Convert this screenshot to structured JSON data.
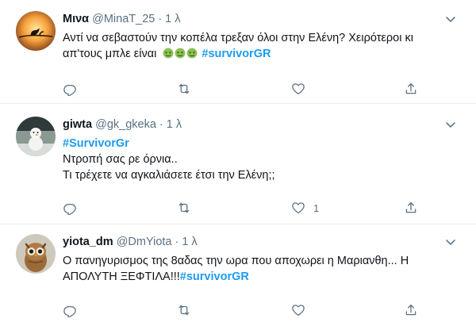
{
  "colors": {
    "hashtag": "#1d9bf0",
    "muted": "#5b7083",
    "icon": "#5b7083"
  },
  "tweets": [
    {
      "name": "Μινα",
      "handle": "@MinaT_25",
      "dot": "·",
      "time": "1 λ",
      "avatar": "bird-on-branch-avatar",
      "lines": [
        "Αντί να σεβαστούν την κοπέλα τρεξαν όλοι στην Ελένη? Χειρότεροι κι",
        "απ'τους μπλε είναι"
      ],
      "emoji": "nauseated-face-emoji",
      "hashtag": "#survivorGR",
      "actions": {
        "reply": "",
        "retweet": "",
        "like": "",
        "share": ""
      }
    },
    {
      "name": "giwta",
      "handle": "@gk_gkeka",
      "dot": "·",
      "time": "1 λ",
      "avatar": "snowman-avatar",
      "hashtag": "#SurvivorGr",
      "lines": [
        "Ντροπή σας ρε όρνια..",
        "Τι τρέχετε να αγκαλιάσετε έτσι την Ελένη;;"
      ],
      "actions": {
        "reply": "",
        "retweet": "",
        "like": "1",
        "share": ""
      }
    },
    {
      "name": "yiota_dm",
      "handle": "@DmYiota",
      "dot": "·",
      "time": "1 λ",
      "avatar": "owl-avatar",
      "lines": [
        "Ο πανηγυρισμος της 8αδας την ωρα που αποχωρει η Μαριανθη... Η",
        "ΑΠΟΛΥΤΗ ΞΕΦΤΙΛΑ!!!"
      ],
      "hashtag": "#survivorGR",
      "actions": {
        "reply": "",
        "retweet": "",
        "like": "",
        "share": ""
      }
    }
  ]
}
